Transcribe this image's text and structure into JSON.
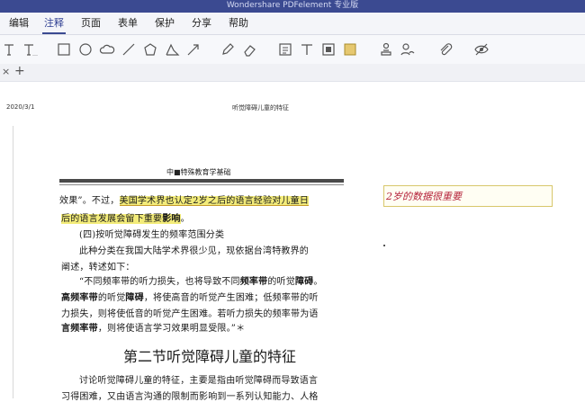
{
  "window": {
    "title": "Wondershare PDFelement 专业版"
  },
  "menu": {
    "items": [
      {
        "id": "edit",
        "label": "编辑"
      },
      {
        "id": "annotate",
        "label": "注释"
      },
      {
        "id": "page",
        "label": "页面"
      },
      {
        "id": "form",
        "label": "表单"
      },
      {
        "id": "protect",
        "label": "保护"
      },
      {
        "id": "share",
        "label": "分享"
      },
      {
        "id": "help",
        "label": "帮助"
      }
    ],
    "active": "注释"
  },
  "toolbar": {
    "tools": [
      "text-icon",
      "typewriter-text-icon",
      "rectangle-icon",
      "oval-icon",
      "cloud-icon",
      "line-icon",
      "polygon-icon",
      "polyline-icon",
      "arrow-icon",
      "pencil-icon",
      "eraser-icon",
      "text-box-icon",
      "callout-icon",
      "text-field-icon",
      "note-icon",
      "stamp-icon",
      "signature-icon",
      "attachment-icon",
      "hide-annotations-icon"
    ]
  },
  "tabs": {
    "close": "×",
    "add": "+"
  },
  "document": {
    "header_date": "2020/3/1",
    "header_title": "听觉障碍儿童的特征",
    "book_header": "中■特殊教育学基础",
    "lines": {
      "l1_a": "效果”。不过，",
      "l1_b": "美国学术界也认定2岁之后的语言经验对儿童日",
      "l2_a": "后的语言发展会留下重要",
      "l2_b": "影响",
      "l2_c": "。",
      "l3": "(四)按听觉障碍发生的频率范围分类",
      "l4": "此种分类在我国大陆学术界很少见，现依据台湾特教界的",
      "l5": "阐述，转述如下：",
      "l6_a": "“不同频率带的听力损失，也将导致不同",
      "l6_b": "频率带",
      "l6_c": "的听觉",
      "l6_d": "障碍",
      "l6_e": "。",
      "l7_a": "高频率带",
      "l7_b": "的听觉",
      "l7_c": "障碍",
      "l7_d": "，将使高音的听觉产生困难；低频率带的听",
      "l8": "力损失，则将使低音的听觉产生困难。若听力损失的频率带为语",
      "l9_a": "言频率带",
      "l9_b": "，则将使语言学习效果明显受限。”＊",
      "section_title": "第二节听觉障碍儿童的特征",
      "l10": "讨论听觉障碍儿童的特征，主要是指由听觉障碍而导致语言",
      "l11": "习得困难，又由语言沟通的限制而影响到一系列认知能力、人格"
    },
    "comment": {
      "text": "2岁的数据很重要"
    }
  },
  "colors": {
    "titlebar": "#3b4a91",
    "highlight": "#f3ec7a",
    "comment_text": "#b4213a"
  }
}
